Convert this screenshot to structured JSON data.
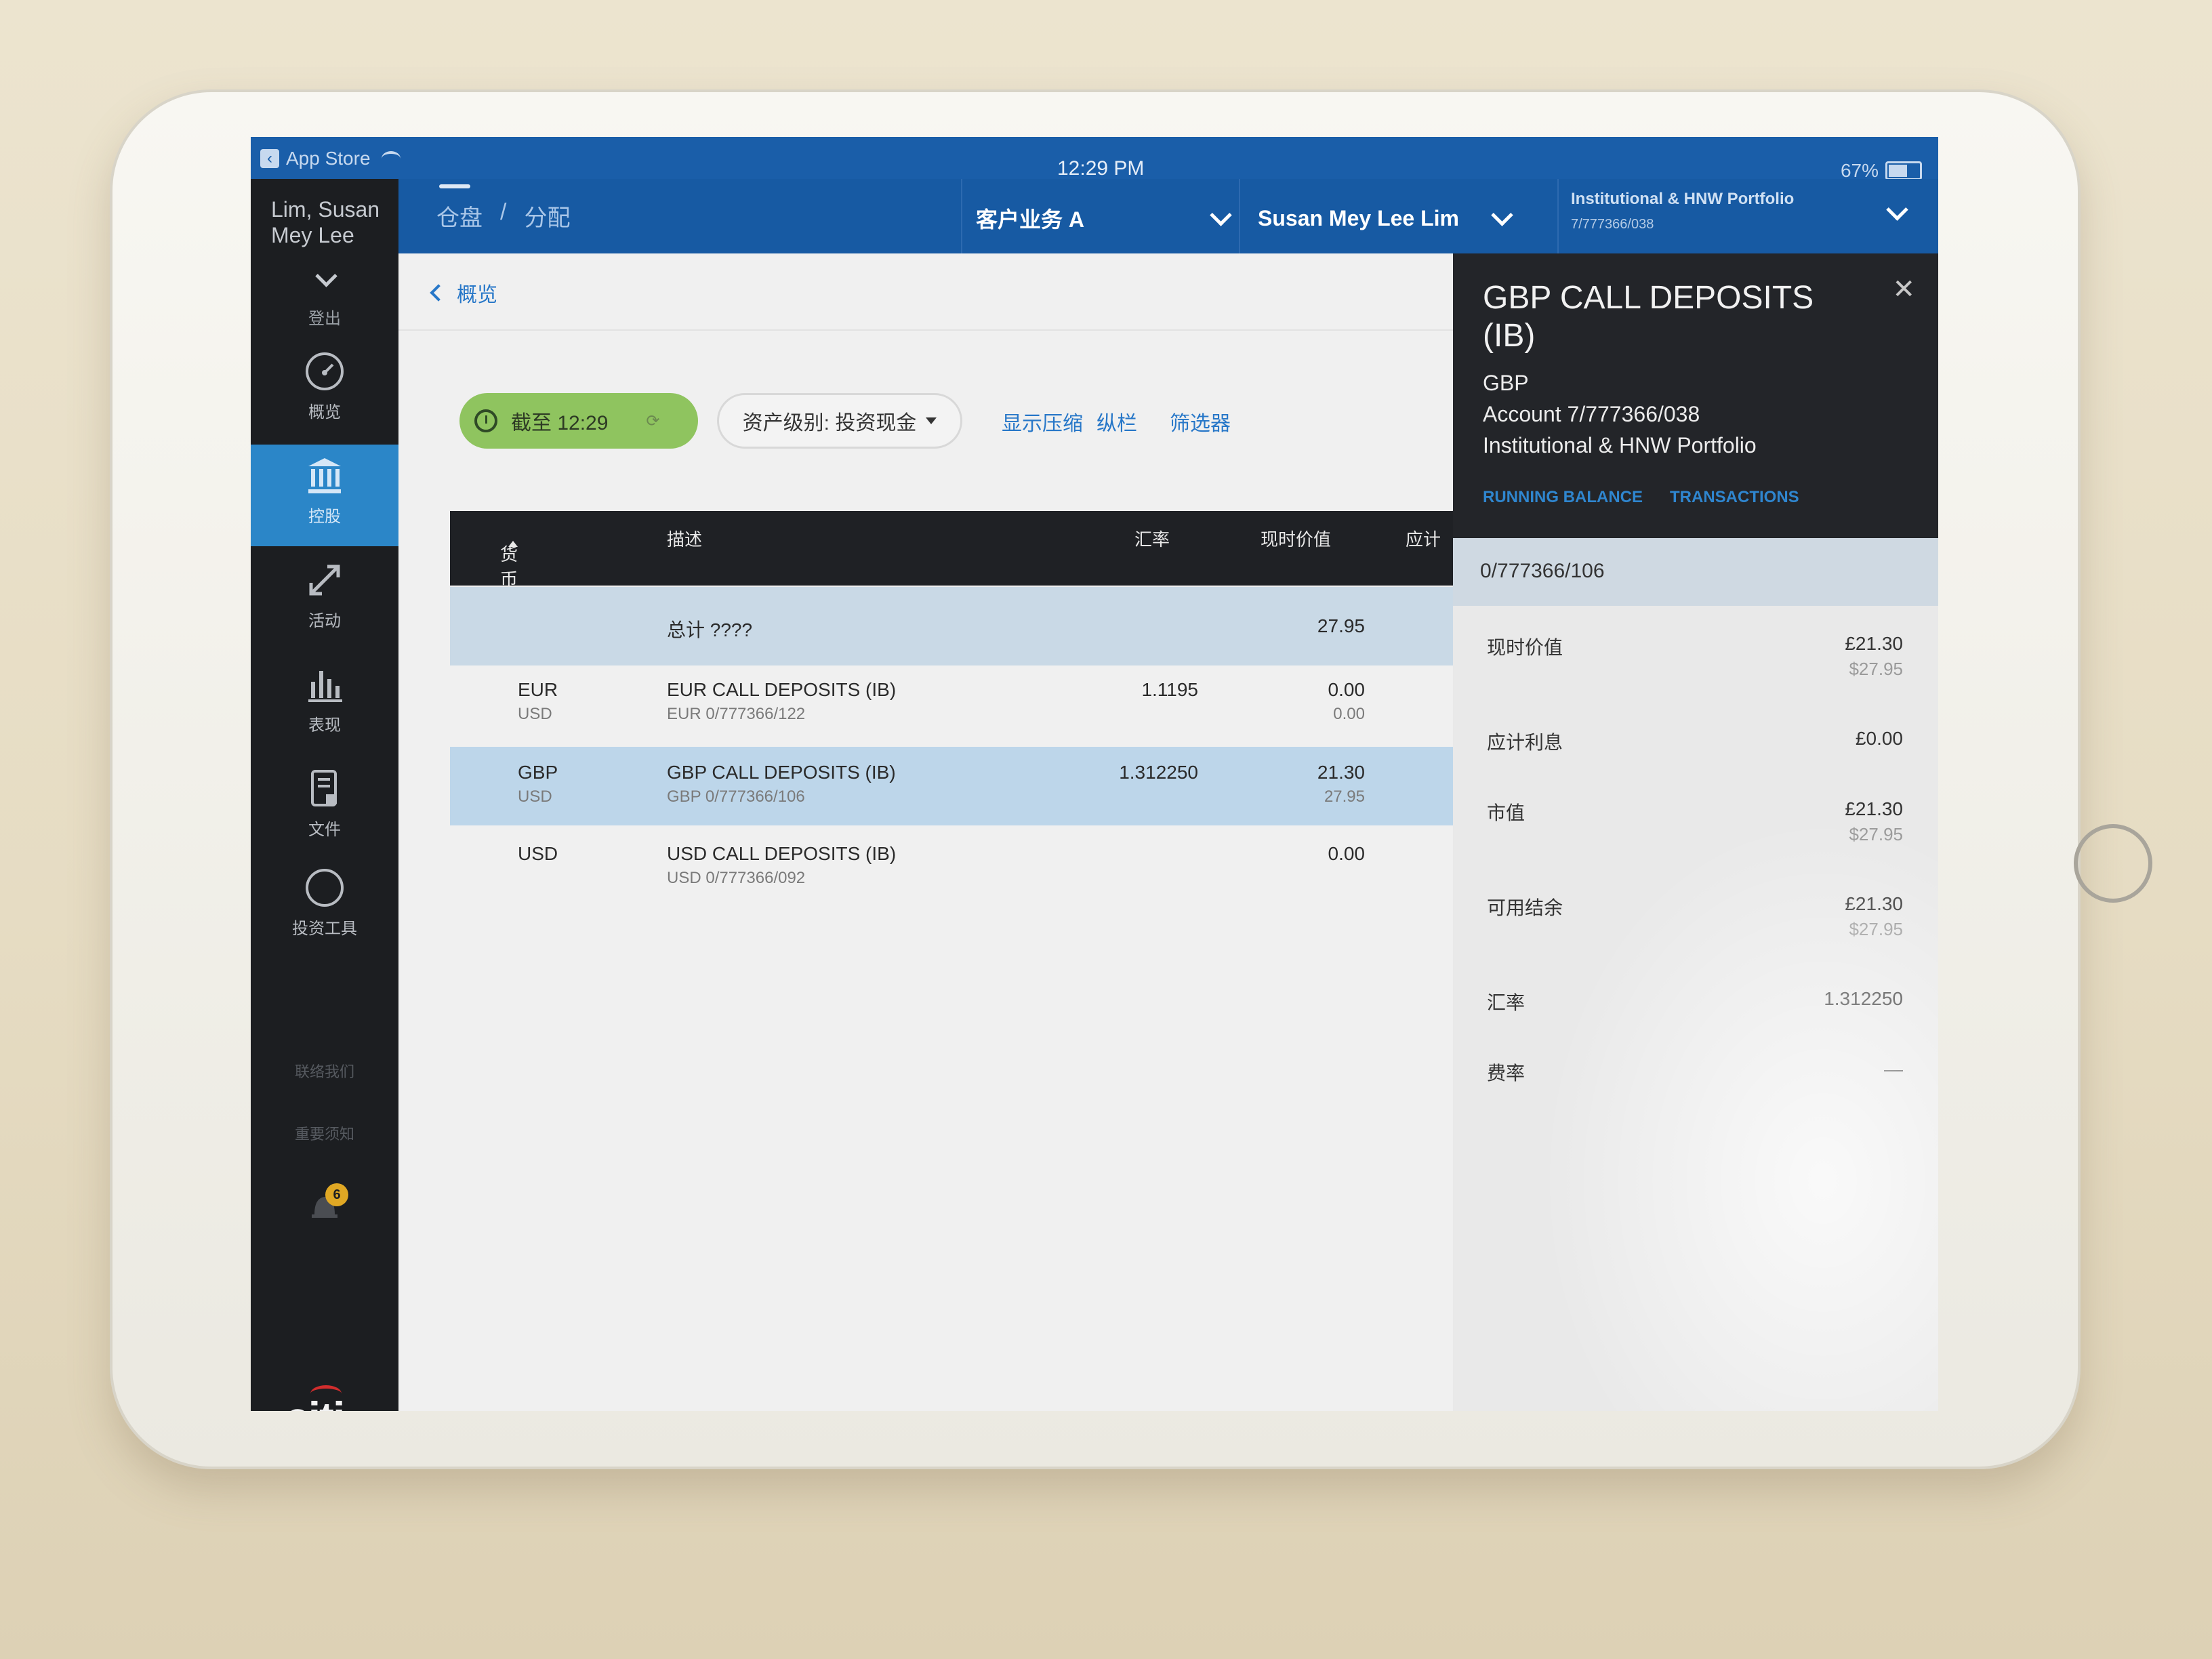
{
  "statusbar": {
    "back_app": "App Store",
    "time": "12:29 PM",
    "battery": "67%",
    "battery_level": 0.67
  },
  "header": {
    "breadcrumb": [
      "仓盘",
      "/",
      "分配"
    ],
    "client_select": "客户业务 A",
    "user_select": "Susan Mey Lee Lim",
    "portfolio_name": "Institutional & HNW Portfolio",
    "portfolio_account": "7/777366/038"
  },
  "sidebar": {
    "user_name": "Lim, Susan Mey Lee",
    "logout": "登出",
    "items": [
      {
        "label": "概览",
        "icon": "speedometer-icon"
      },
      {
        "label": "控股",
        "icon": "bank-icon"
      },
      {
        "label": "活动",
        "icon": "arrows-expand-icon"
      },
      {
        "label": "表现",
        "icon": "bar-chart-icon"
      },
      {
        "label": "文件",
        "icon": "document-lock-icon"
      },
      {
        "label": "投资工具",
        "icon": "compass-icon"
      }
    ],
    "contact": "联络我们",
    "notice": "重要须知",
    "notification_count": "6",
    "logo": "citi"
  },
  "main": {
    "back_label": "概览",
    "as_of": "截至 12:29",
    "asset_class": "资产级别: 投资现金",
    "links": [
      "显示压缩",
      "纵栏",
      "筛选器"
    ],
    "columns": [
      "货币",
      "描述",
      "汇率",
      "现时价值",
      "应计"
    ],
    "total": {
      "label": "总计 ????",
      "value": "27.95"
    },
    "rows": [
      {
        "ccy": "EUR",
        "ccy2": "USD",
        "desc": "EUR CALL DEPOSITS (IB)",
        "acct": "EUR 0/777366/122",
        "rate": "1.1195",
        "value": "0.00",
        "value2": "0.00"
      },
      {
        "ccy": "GBP",
        "ccy2": "USD",
        "desc": "GBP CALL DEPOSITS (IB)",
        "acct": "GBP 0/777366/106",
        "rate": "1.312250",
        "value": "21.30",
        "value2": "27.95"
      },
      {
        "ccy": "USD",
        "ccy2": "",
        "desc": "USD CALL DEPOSITS (IB)",
        "acct": "USD 0/777366/092",
        "rate": "",
        "value": "0.00",
        "value2": ""
      }
    ]
  },
  "panel": {
    "title": "GBP CALL DEPOSITS (IB)",
    "currency": "GBP",
    "account": "Account 7/777366/038",
    "portfolio": "Institutional & HNW Portfolio",
    "tabs": [
      "RUNNING BALANCE",
      "TRANSACTIONS"
    ],
    "sub_account": "0/777366/106",
    "details": [
      {
        "label": "现时价值",
        "v1": "£21.30",
        "v2": "$27.95"
      },
      {
        "label": "应计利息",
        "v1": "£0.00",
        "v2": ""
      },
      {
        "label": "市值",
        "v1": "£21.30",
        "v2": "$27.95"
      },
      {
        "label": "可用结余",
        "v1": "£21.30",
        "v2": "$27.95"
      },
      {
        "label": "汇率",
        "v1": "1.312250",
        "v2": ""
      },
      {
        "label": "费率",
        "v1": "—",
        "v2": ""
      }
    ]
  },
  "colors": {
    "header_blue": "#175aa3",
    "sidebar_dark": "#1c1e21",
    "active_blue": "#2b86c8",
    "as_of_green": "#8fc45f",
    "link_blue": "#2777c8"
  }
}
